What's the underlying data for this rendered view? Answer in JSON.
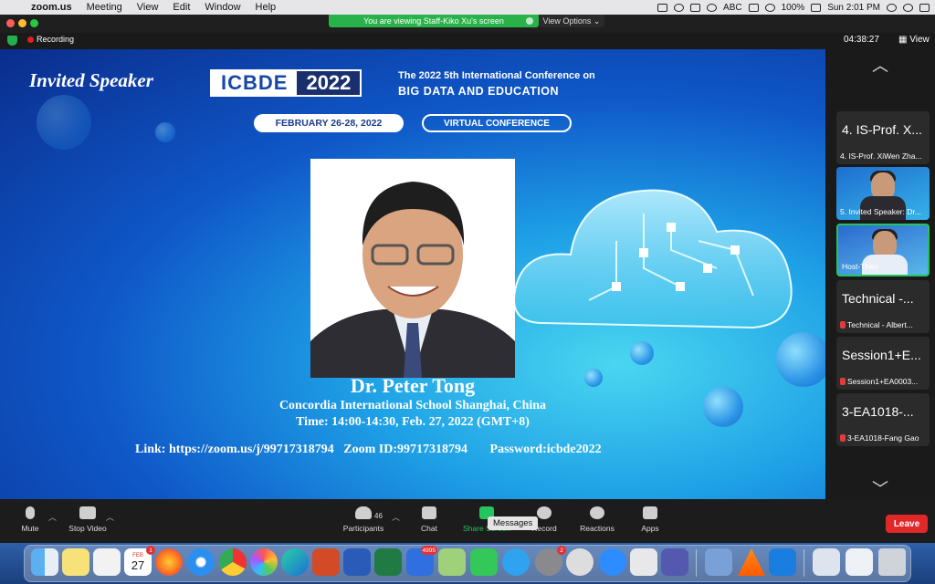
{
  "menubar": {
    "app": "zoom.us",
    "items": [
      "Meeting",
      "View",
      "Edit",
      "Window",
      "Help"
    ],
    "ime": "ABC",
    "battery": "100%",
    "clock": "Sun 2:01 PM"
  },
  "share_banner": {
    "text": "You are viewing Staff-Kiko Xu's screen",
    "view_options": "View Options"
  },
  "meeting": {
    "recording_label": "Recording",
    "timer": "04:38:27",
    "view_label": "View"
  },
  "slide": {
    "invited": "Invited Speaker",
    "logo_left": "ICBDE",
    "logo_right": "2022",
    "conference_line1": "The 2022 5th International Conference on",
    "conference_line2": "BIG DATA AND EDUCATION",
    "date_pill": "FEBRUARY 26-28, 2022",
    "virtual_pill": "VIRTUAL CONFERENCE",
    "speaker_name": "Dr. Peter Tong",
    "organization": "Concordia International School Shanghai, China",
    "time": "Time: 14:00-14:30, Feb. 27, 2022  (GMT+8)",
    "link_line": "Link: https://zoom.us/j/99717318794   Zoom ID:99717318794       Password:icbde2022"
  },
  "participants": [
    {
      "big": "4. IS-Prof. X...",
      "small": "4. IS-Prof. XiWen Zha...",
      "type": "name",
      "muted": false
    },
    {
      "small": "5. Invited Speaker: Dr...",
      "type": "video",
      "muted": false
    },
    {
      "small": "Host-Theo",
      "type": "video",
      "muted": false,
      "active": true
    },
    {
      "big": "Technical -...",
      "small": "Technical - Albert...",
      "type": "name",
      "muted": true
    },
    {
      "big": "Session1+E...",
      "small": "Session1+EA0003...",
      "type": "name",
      "muted": true
    },
    {
      "big": "3-EA1018-...",
      "small": "3-EA1018-Fang Gao",
      "type": "name",
      "muted": true
    }
  ],
  "toolbar": {
    "mute": "Mute",
    "stop_video": "Stop Video",
    "participants": "Participants",
    "participant_count": "46",
    "chat": "Chat",
    "share_screen": "Share Screen",
    "record": "Record",
    "reactions": "Reactions",
    "apps": "Apps",
    "leave": "Leave",
    "tooltip": "Messages"
  },
  "dock": {
    "calendar_month": "FEB",
    "calendar_day": "27",
    "calendar_badge": "1",
    "mail_badge": "4995",
    "prefs_badge": "2"
  }
}
